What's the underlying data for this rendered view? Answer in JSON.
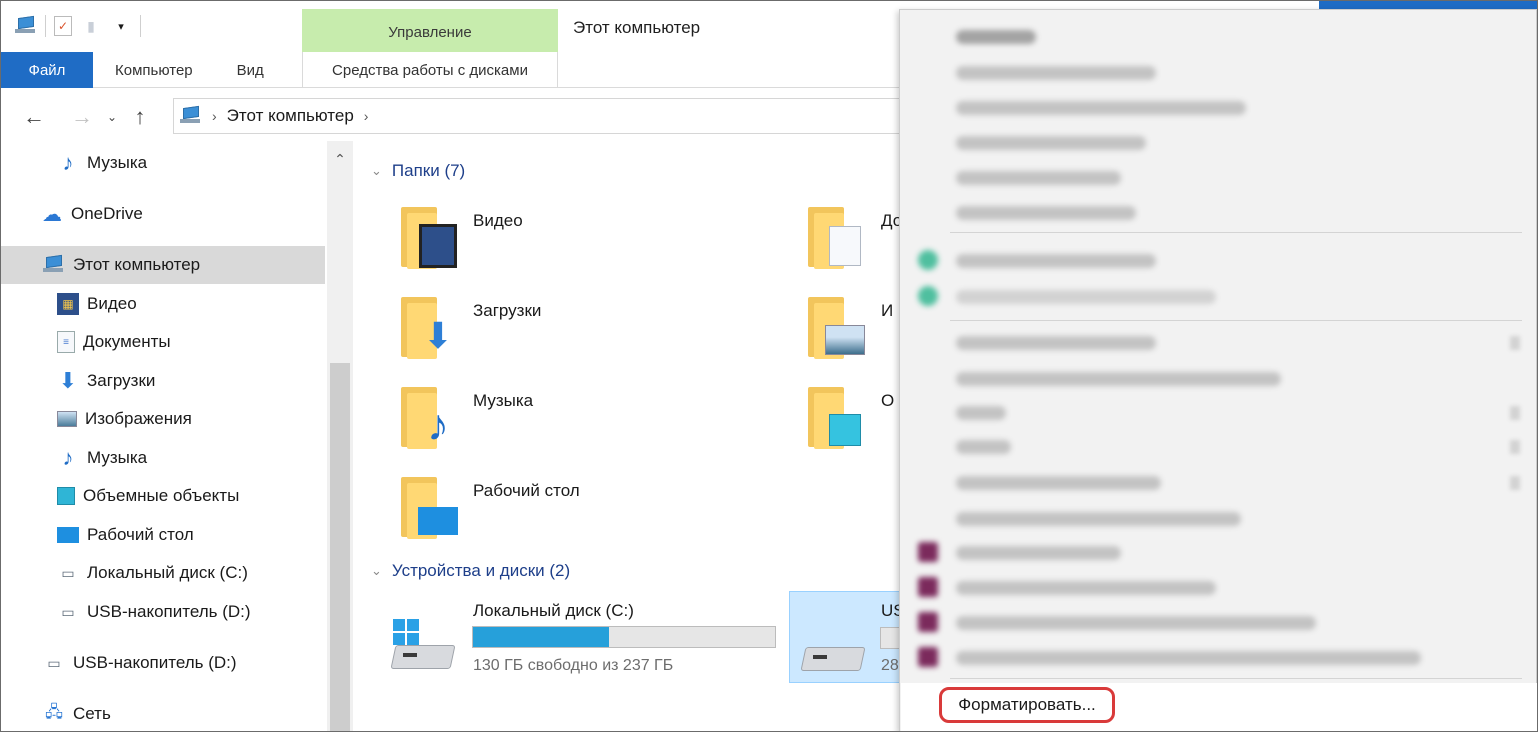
{
  "window": {
    "title": "Этот компьютер",
    "contextual_group": "Управление"
  },
  "ribbon": {
    "tabs": [
      {
        "label": "Файл"
      },
      {
        "label": "Компьютер"
      },
      {
        "label": "Вид"
      },
      {
        "label": "Средства работы с дисками"
      }
    ]
  },
  "address": {
    "crumb": "Этот компьютер"
  },
  "sidebar": {
    "items": [
      {
        "label": "Музыка",
        "icon": "music-icon"
      },
      {
        "label": "OneDrive",
        "icon": "cloud-icon"
      },
      {
        "label": "Этот компьютер",
        "icon": "computer-icon"
      },
      {
        "label": "Видео",
        "icon": "video-icon"
      },
      {
        "label": "Документы",
        "icon": "document-icon"
      },
      {
        "label": "Загрузки",
        "icon": "download-icon"
      },
      {
        "label": "Изображения",
        "icon": "image-icon"
      },
      {
        "label": "Музыка",
        "icon": "music-icon"
      },
      {
        "label": "Объемные объекты",
        "icon": "cube-icon"
      },
      {
        "label": "Рабочий стол",
        "icon": "desktop-icon"
      },
      {
        "label": "Локальный диск (C:)",
        "icon": "drive-icon"
      },
      {
        "label": "USB-накопитель (D:)",
        "icon": "usb-drive-icon"
      },
      {
        "label": "USB-накопитель (D:)",
        "icon": "usb-drive-icon"
      },
      {
        "label": "Сеть",
        "icon": "network-icon"
      }
    ]
  },
  "content": {
    "folders_header": "Папки (7)",
    "folders": [
      {
        "label": "Видео"
      },
      {
        "label": "Загрузки"
      },
      {
        "label": "Музыка"
      },
      {
        "label": "Рабочий стол"
      },
      {
        "label": "До"
      },
      {
        "label": "И"
      },
      {
        "label": "О"
      }
    ],
    "devices_header": "Устройства и диски (2)",
    "drives": [
      {
        "label": "Локальный диск (C:)",
        "free": "130 ГБ свободно из 237 ГБ",
        "used_fraction": 0.45
      },
      {
        "label": "US",
        "free": "28"
      }
    ]
  },
  "context_menu": {
    "format_label": "Форматировать..."
  }
}
